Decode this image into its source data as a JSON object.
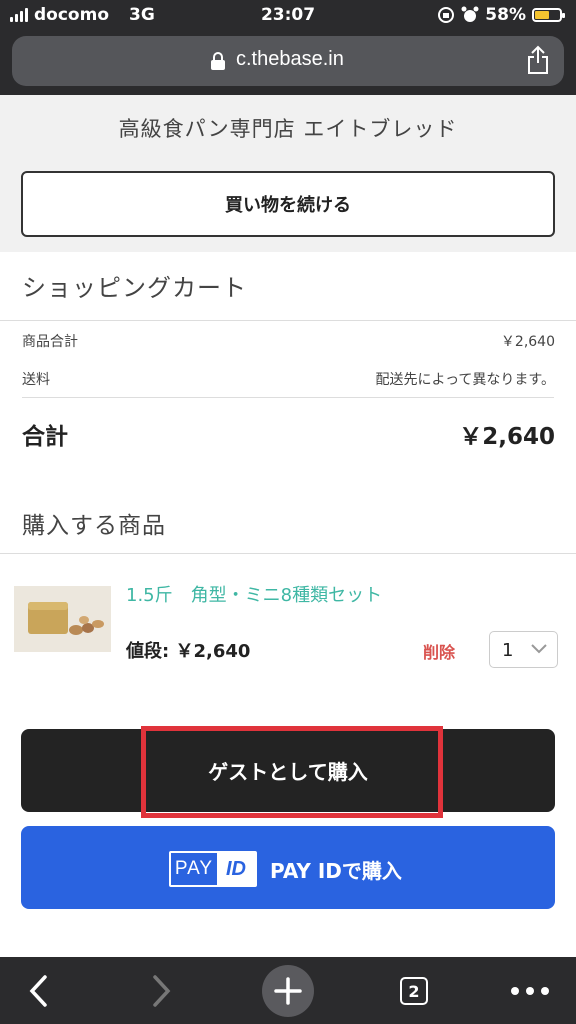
{
  "status_bar": {
    "carrier": "docomo",
    "network": "3G",
    "time": "23:07",
    "battery_percent": "58%",
    "battery_level": 0.58
  },
  "browser": {
    "url": "c.thebase.in",
    "tab_count": "2"
  },
  "shop": {
    "name": "高級食パン専門店 エイトブレッド",
    "continue_label": "買い物を続ける"
  },
  "cart": {
    "title": "ショッピングカート",
    "subtotal_label": "商品合計",
    "subtotal_value": "￥2,640",
    "shipping_label": "送料",
    "shipping_value": "配送先によって異なります。",
    "total_label": "合計",
    "total_value": "￥2,640"
  },
  "items": {
    "title": "購入する商品",
    "list": [
      {
        "name": "1.5斤　角型・ミニ8種類セット",
        "price": "値段: ￥2,640",
        "delete_label": "削除",
        "quantity": "1"
      }
    ]
  },
  "actions": {
    "guest_label": "ゲストとして購入",
    "payid_logo_pay": "PAY",
    "payid_logo_id": "ID",
    "payid_label": "PAY IDで購入"
  },
  "colors": {
    "accent_teal": "#3fb7a4",
    "delete_red": "#d9534f",
    "payid_blue": "#2a63e0",
    "highlight_red": "#e0333b"
  }
}
